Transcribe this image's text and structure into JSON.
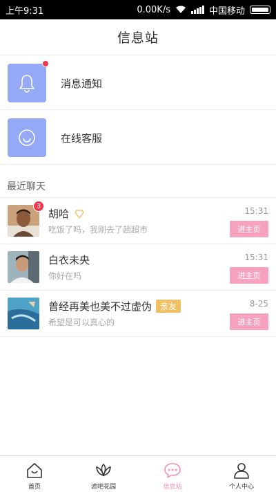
{
  "status_bar": {
    "time": "上午9:31",
    "speed": "0.00K/s",
    "carrier": "中国移动"
  },
  "header": {
    "title": "信息站"
  },
  "menu": [
    {
      "label": "消息通知",
      "icon": "bell-icon",
      "has_dot": true
    },
    {
      "label": "在线客服",
      "icon": "smiley-icon",
      "has_dot": false
    }
  ],
  "section_title": "最近聊天",
  "chats": [
    {
      "name": "胡哈",
      "message": "吃饭了吗，我刚去了趟超市",
      "time": "15:31",
      "badge": "3",
      "button": "进主页",
      "vip": true,
      "tag": ""
    },
    {
      "name": "白衣未央",
      "message": "你好在吗",
      "time": "15:31",
      "badge": "",
      "button": "进主页",
      "vip": false,
      "tag": ""
    },
    {
      "name": "曾经再美也美不过虚伪",
      "message": "希望是可以真心的",
      "time": "8-25",
      "badge": "",
      "button": "进主页",
      "vip": false,
      "tag": "亲友"
    }
  ],
  "bottom_nav": [
    {
      "label": "首页",
      "icon": "home-icon",
      "active": false
    },
    {
      "label": "滤吧花园",
      "icon": "flower-icon",
      "active": false
    },
    {
      "label": "信息站",
      "icon": "chat-bubble-icon",
      "active": true
    },
    {
      "label": "个人中心",
      "icon": "person-icon",
      "active": false
    }
  ],
  "colors": {
    "accent": "#f7a3c0",
    "menu_icon_bg": "#95a9f7",
    "badge": "#f0374b",
    "tag": "#f2c062"
  }
}
